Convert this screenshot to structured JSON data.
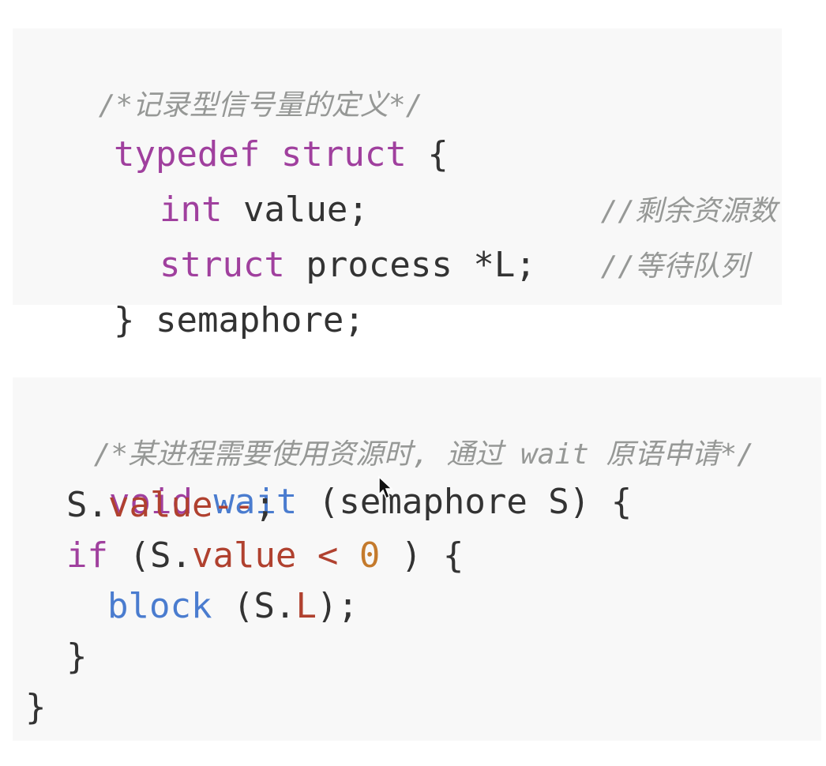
{
  "snippet1": {
    "comment": "/*记录型信号量的定义*/",
    "line1": {
      "kw": "typedef",
      "kw2": "struct",
      "brace": "{"
    },
    "line2": {
      "type": "int",
      "name": "value;",
      "comment": "//剩余资源数"
    },
    "line3": {
      "type": "struct",
      "name": "process",
      "ptr": "*L;",
      "comment": "//等待队列"
    },
    "line4": {
      "close": "}",
      "name": "semaphore;"
    }
  },
  "snippet2": {
    "comment": "/*某进程需要使用资源时, 通过 wait 原语申请*/",
    "line1": {
      "type": "void",
      "fn": "wait",
      "params": "(semaphore S)",
      "brace": "{"
    },
    "line2": {
      "obj": "S.",
      "prop": "value",
      "op": "--",
      "end": ";"
    },
    "line3": {
      "kw": "if",
      "open": "(S.",
      "prop": "value",
      "op": "<",
      "num": "0",
      "close": ") {"
    },
    "line4": {
      "fn": "block",
      "open": "(S.",
      "prop": "L",
      "close": ");"
    },
    "line5": {
      "close": "}"
    },
    "line6": {
      "close": "}"
    }
  },
  "icons": {
    "cursor": "mouse-pointer-icon"
  }
}
